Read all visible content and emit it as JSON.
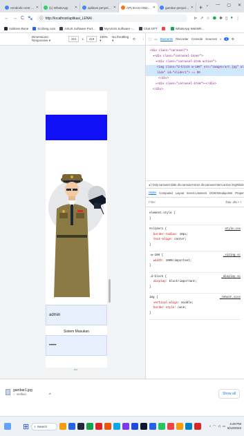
{
  "browser": {
    "tabs": [
      {
        "label": "rembrolin vent adalah - Go",
        "fav_color": "#4285f4",
        "active": false
      },
      {
        "label": "(1) WhatsApp",
        "fav_color": "#25d366",
        "active": false
      },
      {
        "label": "aplikasi penyeldikan poris",
        "fav_color": "#4285f4",
        "active": false
      },
      {
        "label": "APLIKASI ANDROID",
        "fav_color": "#f97316",
        "active": true
      },
      {
        "label": "gambar penyidik - Googl",
        "fav_color": "#4285f4",
        "active": false
      }
    ],
    "new_tab": "+",
    "address": "http://localhost/aplikasi_LENA/",
    "bookmarks": [
      {
        "label": "Address Bone",
        "color": "#1f2937"
      },
      {
        "label": "Scribing.com",
        "color": "#2563eb"
      },
      {
        "label": "ASUS Software Port...",
        "color": "#374151"
      },
      {
        "label": "MyASUS Software -...",
        "color": "#374151"
      },
      {
        "label": "Chat GPT",
        "color": "#374151"
      },
      {
        "label": "",
        "color": "#ef4444"
      },
      {
        "label": "WhatsApp WebWh...",
        "color": "#16a34a"
      }
    ]
  },
  "device_toolbar": {
    "mode": "Dimensions: Responsive ▾",
    "width": "321",
    "x": "x",
    "height": "419",
    "zoom": "100% ▾",
    "throttle": "No throttling ▾"
  },
  "app": {
    "caption": "Sistem Masukan",
    "username": "admin",
    "password": "•••••"
  },
  "devtools": {
    "tabs": [
      "Elements",
      "Recorder",
      "Console",
      "Sources",
      "»"
    ],
    "badge": "1",
    "dom_lines": [
      "<div class=\"carousel\">",
      "▾<div class=\"carousel-inner\">",
      "▾<div class=\"carousel-item active\">",
      "<img class=\"d-block w-100\" src=\"images/art.jpg\" alt=\"Fir",
      "lide\" id=\"slider1\"> == $0",
      "</div>",
      "▸<div class=\"carousel-item\">⋯</div>",
      "</div>"
    ],
    "breadcrumbs": "◂ l.Only.carousel.slide  div.carousel-inner  div.carousel-item.active  img#slider1.d-block.w",
    "style_tabs": [
      "Styles",
      "Computed",
      "Layout",
      "Event Listeners",
      "DOM Breakpoints",
      "Properties",
      "Accessi"
    ],
    "filter_placeholder": "Filter",
    "filter_right": ":hov .cls + ⁝",
    "rules": [
      {
        "selector": "element.style {",
        "source": "",
        "props": [],
        "close": "}"
      },
      {
        "selector": "#slider1 {",
        "source": "style.css",
        "props": [
          [
            "border-radius",
            "10px;"
          ],
          [
            "text-align",
            "center;"
          ]
        ],
        "close": "}"
      },
      {
        "selector": ".w-100 {",
        "source": "_sizing.sc",
        "props": [
          [
            "width",
            "100%!important;"
          ]
        ],
        "close": "}"
      },
      {
        "selector": ".d-block {",
        "source": "_display.sc",
        "props": [
          [
            "display",
            "block!important;"
          ]
        ],
        "close": "}"
      },
      {
        "selector": "img {",
        "source": "_reboot.scss",
        "props": [
          [
            "vertical-align",
            "middle;"
          ],
          [
            "border-style",
            "none;"
          ]
        ],
        "close": "}"
      }
    ]
  },
  "downloads": {
    "filename": "gambar1.jpg",
    "status": "✓ Verified",
    "show_all": "Show all"
  },
  "taskbar": {
    "search": "Search",
    "time": "4:49 PM",
    "date": "8/13/2023",
    "icons": [
      "#f59e0b",
      "#2563eb",
      "#1f2937",
      "#16a34a",
      "#dc2626",
      "#ea580c",
      "#0ea5e9",
      "#7c3aed",
      "#1d4ed8",
      "#0f172a",
      "#2563eb",
      "#22c55e",
      "#ef4444",
      "#f59e0b",
      "#0284c7",
      "#dc2626"
    ]
  }
}
